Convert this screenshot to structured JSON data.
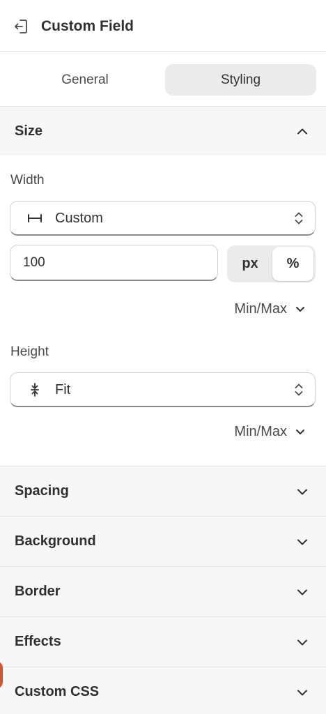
{
  "header": {
    "title": "Custom Field",
    "back_icon": "exit-icon"
  },
  "tabs": [
    {
      "label": "General",
      "active": false
    },
    {
      "label": "Styling",
      "active": true
    }
  ],
  "size_section": {
    "title": "Size",
    "expanded": true,
    "width": {
      "label": "Width",
      "select_value": "Custom",
      "select_icon": "horizontal-span-icon",
      "input_value": "100",
      "units": [
        "px",
        "%"
      ],
      "selected_unit": "%",
      "minmax_label": "Min/Max"
    },
    "height": {
      "label": "Height",
      "select_value": "Fit",
      "select_icon": "collapse-vertical-icon",
      "minmax_label": "Min/Max"
    }
  },
  "sections": [
    {
      "title": "Spacing"
    },
    {
      "title": "Background"
    },
    {
      "title": "Border"
    },
    {
      "title": "Effects"
    },
    {
      "title": "Custom CSS"
    }
  ]
}
